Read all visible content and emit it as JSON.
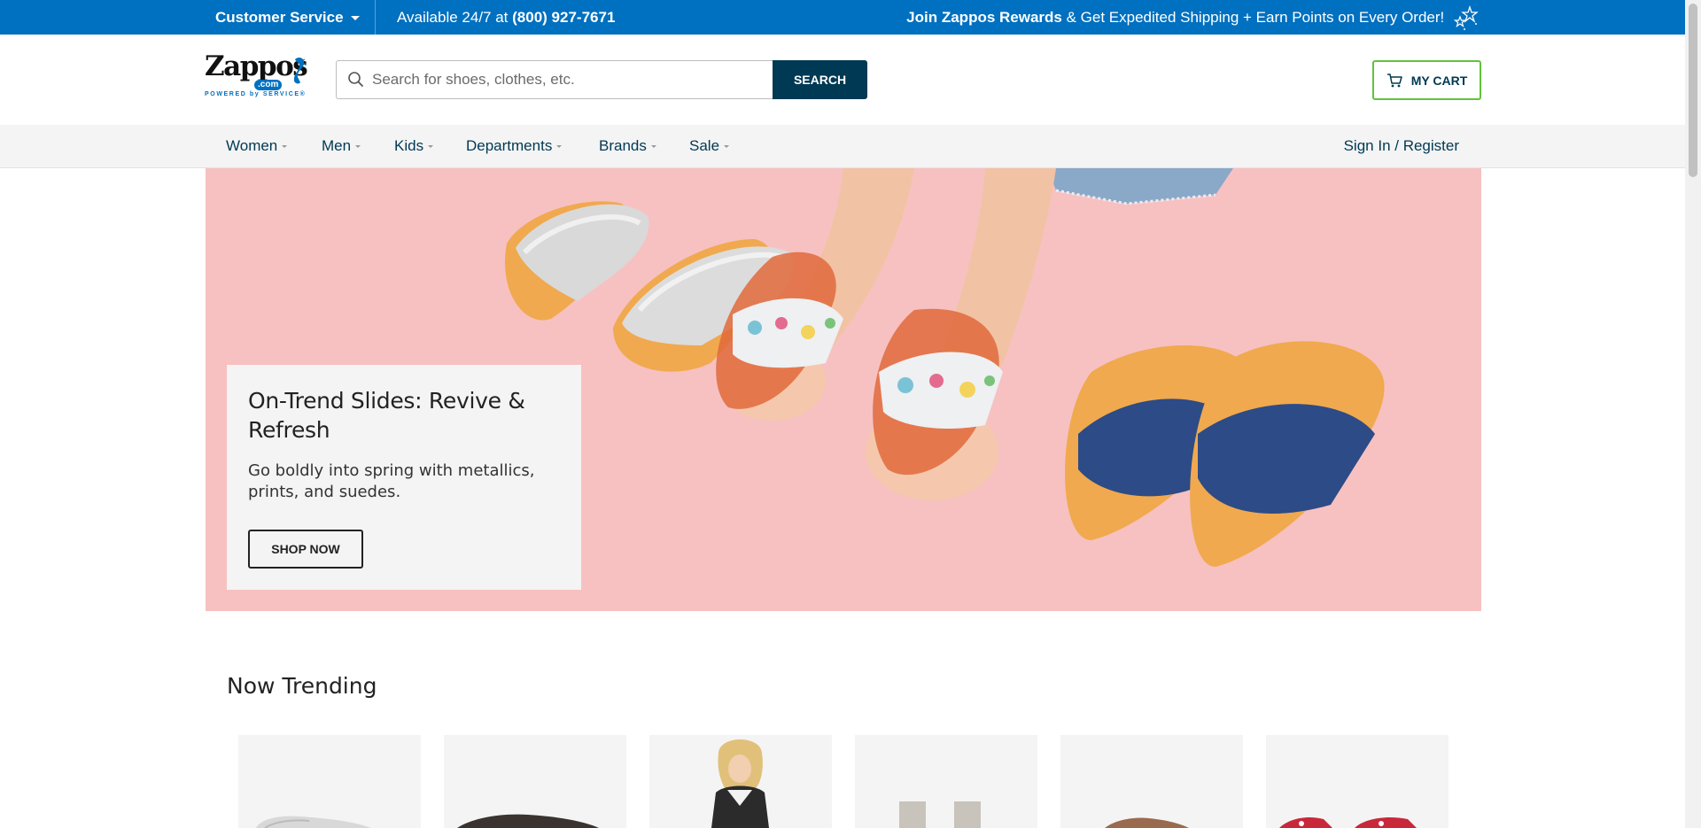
{
  "topbar": {
    "customer_service": "Customer Service",
    "available_prefix": "Available 24/7 at",
    "phone": "(800) 927-7671",
    "rewards_bold": "Join Zappos Rewards",
    "rewards_rest": "& Get Expedited Shipping + Earn Points on Every Order!",
    "rewards_icon": "stars-icon"
  },
  "header": {
    "logo_word": "Zappos",
    "logo_dotcom": ".com",
    "logo_tagline": "POWERED by SERVICE®",
    "search_placeholder": "Search for shoes, clothes, etc.",
    "search_value": "",
    "search_button": "SEARCH",
    "cart_label": "MY CART",
    "cart_icon": "cart-icon"
  },
  "nav": {
    "items": [
      {
        "label": "Women"
      },
      {
        "label": "Men"
      },
      {
        "label": "Kids"
      },
      {
        "label": "Departments"
      },
      {
        "label": "Brands"
      },
      {
        "label": "Sale"
      }
    ],
    "signin": "Sign In / Register"
  },
  "hero": {
    "title": "On-Trend Slides: Revive & Refresh",
    "body": "Go boldly into spring with metallics, prints, and suedes.",
    "cta": "SHOP NOW"
  },
  "trending": {
    "title": "Now Trending"
  },
  "colors": {
    "topbar_bg": "#0070c0",
    "brand_dark": "#003953",
    "cart_border": "#5fc43b",
    "hero_bg": "#f7c1c1",
    "nav_bg": "#f4f4f4"
  }
}
